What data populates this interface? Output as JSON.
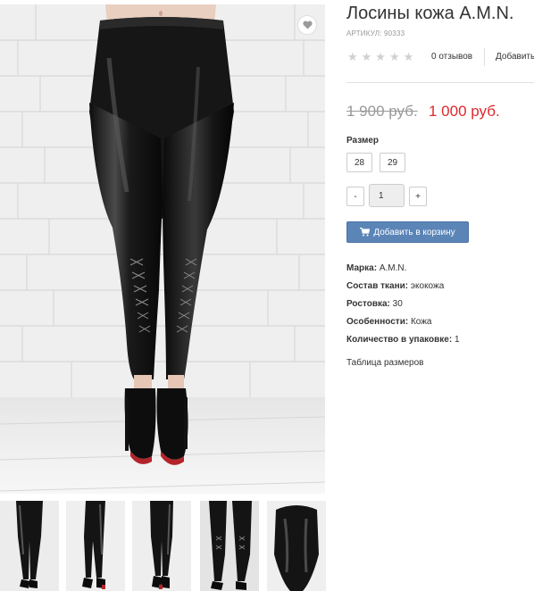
{
  "product": {
    "title": "Лосины кожа A.M.N.",
    "sku": "АРТИКУЛ: 90333",
    "rating_stars": "★★★★★",
    "reviews_label": "0 отзывов",
    "add_review_label": "Добавить",
    "old_price": "1 900 руб.",
    "new_price": "1 000 руб."
  },
  "icons": {
    "favorite": "heart-icon",
    "cart": "cart-icon"
  },
  "size": {
    "label": "Размер",
    "options": [
      "28",
      "29"
    ]
  },
  "quantity": {
    "minus": "-",
    "value": "1",
    "plus": "+"
  },
  "cart_button": {
    "label": "Добавить в корзину"
  },
  "attributes": [
    {
      "name": "Марка:",
      "value": "A.M.N."
    },
    {
      "name": "Состав ткани:",
      "value": "экокожа"
    },
    {
      "name": "Ростовка:",
      "value": "30"
    },
    {
      "name": "Особенности:",
      "value": "Кожа"
    },
    {
      "name": "Количество в упаковке:",
      "value": "1"
    }
  ],
  "size_table_link": "Таблица размеров",
  "colors": {
    "price_red": "#e0282d",
    "button_blue": "#5c85b7",
    "leather": "#1c1c1c",
    "wall": "#eeeeee"
  }
}
